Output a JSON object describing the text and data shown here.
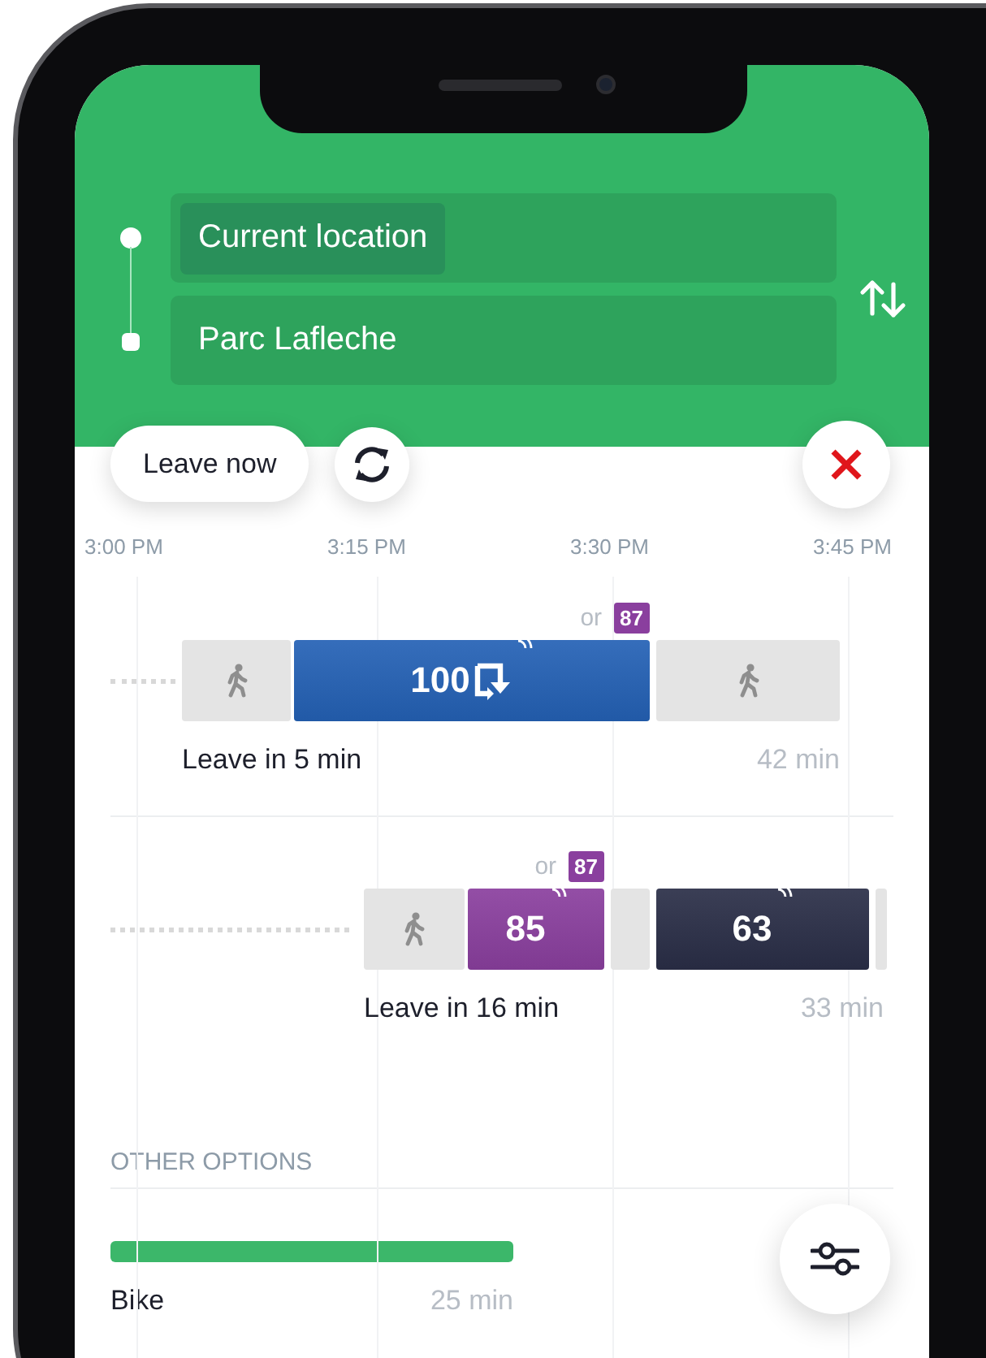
{
  "header": {
    "fields": [
      {
        "value": "Current location",
        "selected": true
      },
      {
        "value": "Parc Lafleche",
        "selected": false
      }
    ]
  },
  "departure_button": "Leave now",
  "timeline": {
    "ticks": [
      "3:00 PM",
      "3:15 PM",
      "3:30 PM",
      "3:45 PM"
    ]
  },
  "trips": [
    {
      "segments": [
        {
          "kind": "wait"
        },
        {
          "kind": "walk"
        },
        {
          "kind": "transit",
          "route": "100",
          "color": "#2461b5",
          "detour": true,
          "realtime": true,
          "alternative": {
            "text": "or",
            "route": "87",
            "color": "#8a3f9e"
          }
        },
        {
          "kind": "walk"
        }
      ],
      "label": "Leave in 5 min",
      "duration": "42 min"
    },
    {
      "segments": [
        {
          "kind": "wait"
        },
        {
          "kind": "walk"
        },
        {
          "kind": "transit",
          "route": "85",
          "color": "#8a3f9e",
          "detour": false,
          "realtime": true,
          "alternative": {
            "text": "or",
            "route": "87",
            "color": "#8a3f9e"
          }
        },
        {
          "kind": "transfer"
        },
        {
          "kind": "transit",
          "route": "63",
          "color": "#2a2e47",
          "detour": false,
          "realtime": true
        },
        {
          "kind": "transfer"
        }
      ],
      "label": "Leave in 16 min",
      "duration": "33 min"
    }
  ],
  "other_options": {
    "title": "OTHER OPTIONS",
    "items": [
      {
        "label": "Bike",
        "duration": "25 min",
        "color": "#3cb76a"
      }
    ]
  }
}
